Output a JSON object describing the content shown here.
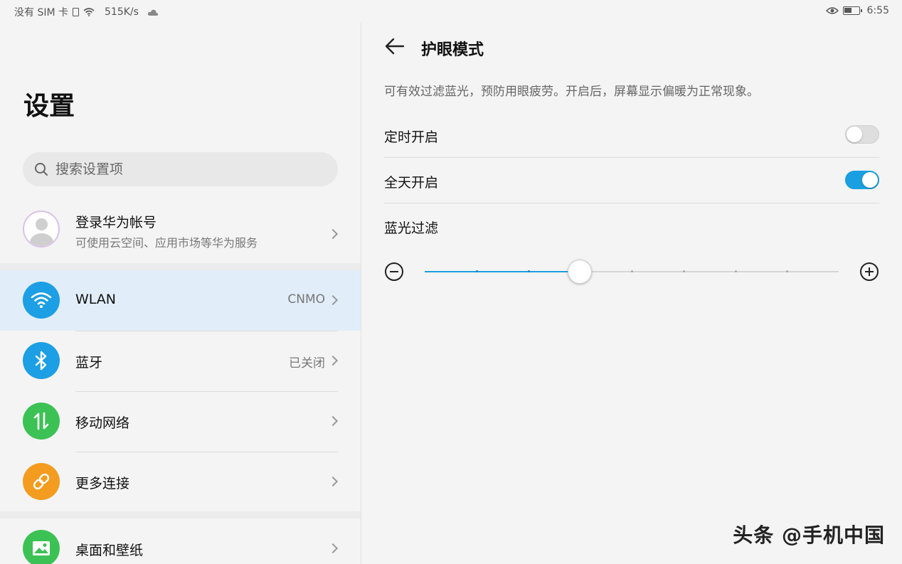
{
  "status_bar": {
    "carrier": "没有 SIM 卡",
    "speed": "515K/s",
    "time": "6:55"
  },
  "left": {
    "title": "设置",
    "search_placeholder": "搜索设置项",
    "account": {
      "name": "登录华为帐号",
      "subtitle": "可使用云空间、应用市场等华为服务"
    },
    "items": [
      {
        "label": "WLAN",
        "value": "CNMO",
        "icon": "wifi-icon",
        "color": "#1c9fe4"
      },
      {
        "label": "蓝牙",
        "value": "已关闭",
        "icon": "bluetooth-icon",
        "color": "#1c9fe4"
      },
      {
        "label": "移动网络",
        "value": "",
        "icon": "mobile-data-icon",
        "color": "#3cc254"
      },
      {
        "label": "更多连接",
        "value": "",
        "icon": "link-icon",
        "color": "#f39c1f"
      },
      {
        "label": "桌面和壁纸",
        "value": "",
        "icon": "image-icon",
        "color": "#3cc254"
      }
    ]
  },
  "right": {
    "title": "护眼模式",
    "description": "可有效过滤蓝光，预防用眼疲劳。开启后，屏幕显示偏暖为正常现象。",
    "scheduled_label": "定时开启",
    "scheduled_on": false,
    "allday_label": "全天开启",
    "allday_on": true,
    "filter_label": "蓝光过滤",
    "filter_level": 0.375,
    "filter_steps": 8
  },
  "colors": {
    "accent": "#1a9fe0",
    "active_row": "#e1eefa"
  },
  "watermark": "头条 @手机中国"
}
